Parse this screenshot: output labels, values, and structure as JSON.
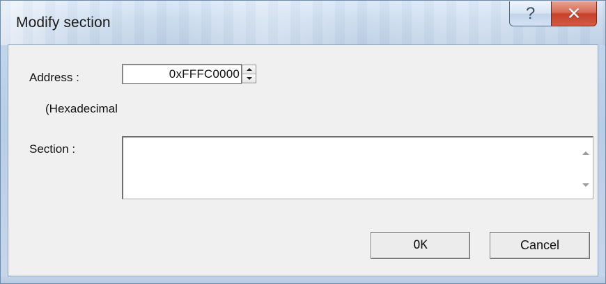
{
  "window": {
    "title": "Modify section"
  },
  "caption": {
    "help_icon": "help-icon",
    "help_glyph": "?",
    "close_icon": "close-icon",
    "close_glyph": "✕"
  },
  "form": {
    "address_label": "Address :",
    "address_value": "0xFFFC0000",
    "hex_note": "(Hexadecimal",
    "section_label": "Section :",
    "section_value": ""
  },
  "buttons": {
    "ok_label": "OK",
    "cancel_label": "Cancel"
  },
  "colors": {
    "close_button": "#c7402a",
    "titlebar": "#c6d8ec",
    "client_background": "#f0f0f0"
  }
}
